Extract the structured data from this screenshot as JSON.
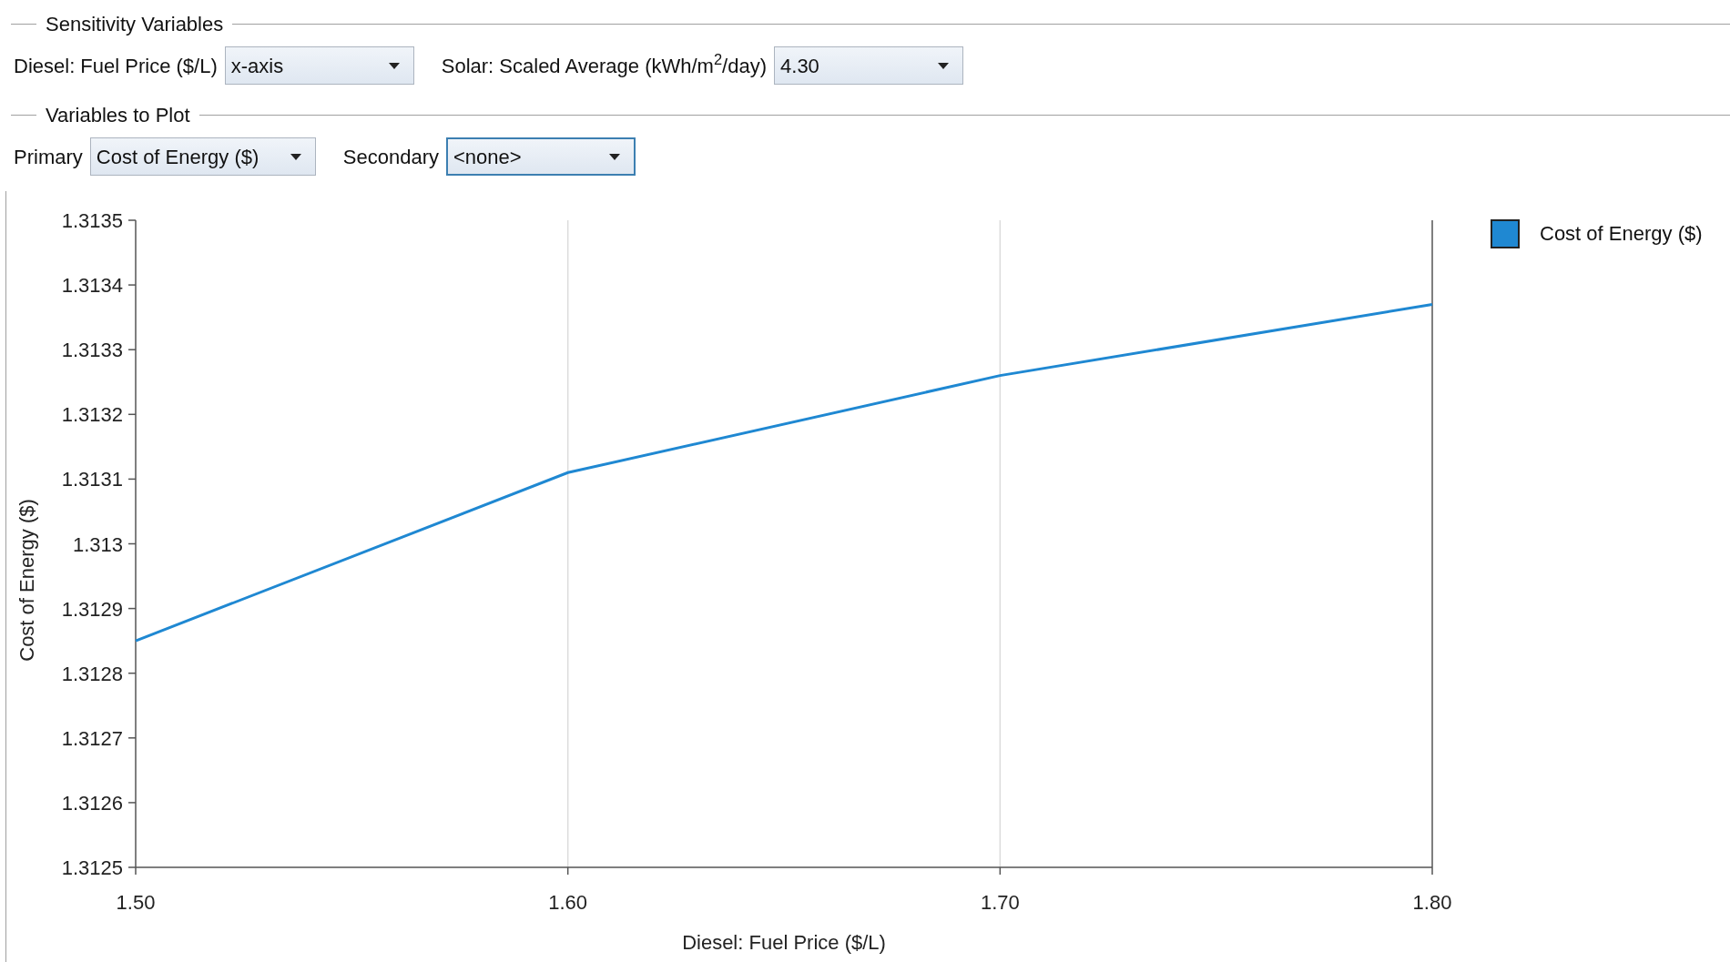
{
  "sensitivity_variables": {
    "title": "Sensitivity Variables",
    "fields": [
      {
        "label": "Diesel: Fuel Price ($/L)",
        "value": "x-axis",
        "focused": false
      },
      {
        "label": "Solar: Scaled Average (kWh/m$^{2}$/day)",
        "value": "4.30",
        "focused": false
      }
    ]
  },
  "variables_to_plot": {
    "title": "Variables to Plot",
    "fields": [
      {
        "label": "Primary",
        "value": "Cost of Energy ($)",
        "focused": false
      },
      {
        "label": "Secondary",
        "value": "<none>",
        "focused": true
      }
    ]
  },
  "chart": {
    "chart_data": {
      "type": "line",
      "xlabel": "Diesel: Fuel Price ($/L)",
      "ylabel": "Cost of Energy ($)",
      "x": [
        1.5,
        1.6,
        1.7,
        1.8
      ],
      "series": [
        {
          "name": "Cost of Energy ($)",
          "color": "#1f88d2",
          "values": [
            1.31285,
            1.31311,
            1.31326,
            1.31337
          ]
        }
      ],
      "xlim": [
        1.5,
        1.8
      ],
      "ylim": [
        1.3125,
        1.3135
      ],
      "xticks": [
        {
          "value": 1.5,
          "label": "1.50"
        },
        {
          "value": 1.6,
          "label": "1.60"
        },
        {
          "value": 1.7,
          "label": "1.70"
        },
        {
          "value": 1.8,
          "label": "1.80"
        }
      ],
      "yticks": [
        1.3135,
        1.3134,
        1.3133,
        1.3132,
        1.3131,
        1.313,
        1.3129,
        1.3128,
        1.3127,
        1.3126,
        1.3125
      ]
    }
  }
}
